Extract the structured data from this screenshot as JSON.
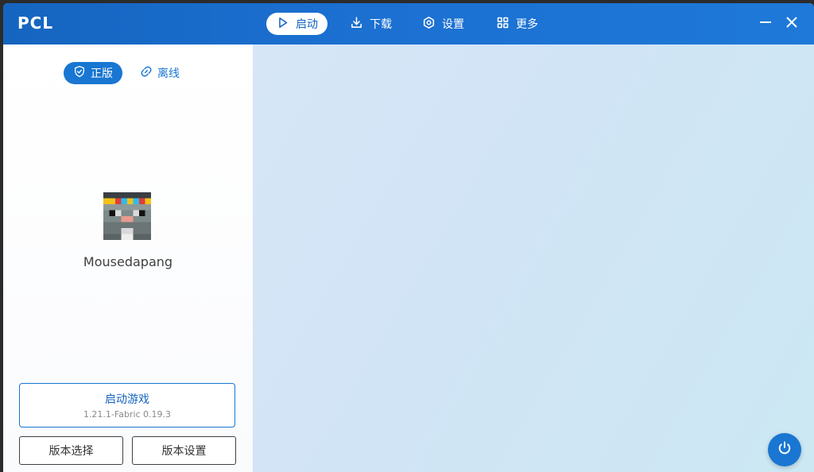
{
  "app": {
    "title": "PCL"
  },
  "nav": {
    "tabs": [
      {
        "label": "启动",
        "icon": "play-icon",
        "active": true
      },
      {
        "label": "下载",
        "icon": "download-icon",
        "active": false
      },
      {
        "label": "设置",
        "icon": "gear-icon",
        "active": false
      },
      {
        "label": "更多",
        "icon": "grid-icon",
        "active": false
      }
    ]
  },
  "auth": {
    "official": {
      "label": "正版",
      "icon": "shield-check-icon",
      "active": true
    },
    "offline": {
      "label": "离线",
      "icon": "link-icon",
      "active": false
    }
  },
  "profile": {
    "username": "Mousedapang",
    "avatar_icon": "player-skin-head-icon"
  },
  "launch": {
    "title": "启动游戏",
    "version": "1.21.1-Fabric 0.19.3"
  },
  "buttons": {
    "version_select": "版本选择",
    "version_settings": "版本设置"
  },
  "colors": {
    "accent": "#1976d2",
    "titlebar": "#1565c0"
  }
}
